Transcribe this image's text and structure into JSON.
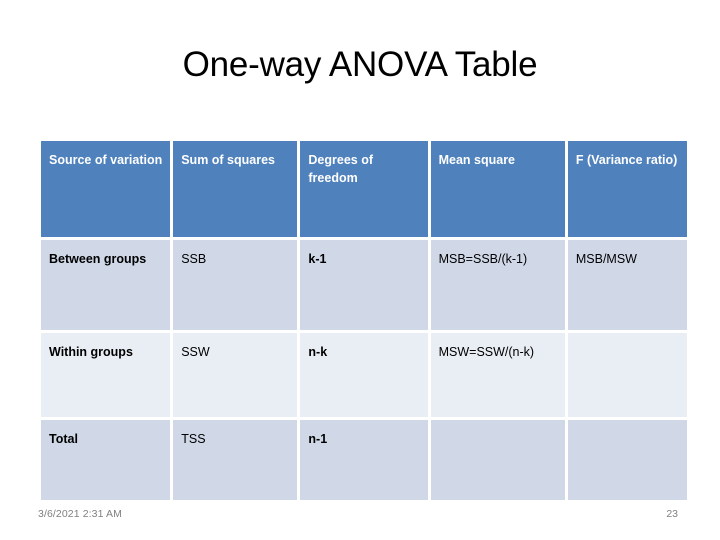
{
  "slide": {
    "title": "One-way ANOVA Table",
    "colors": {
      "header_fill": "#4F81BD",
      "band_row_fill": "#D0D8E8",
      "plain_row_fill": "#E9EDF4",
      "header_text": "#FFFFFF",
      "body_text": "#000000",
      "footer_text": "#808080"
    }
  },
  "table": {
    "headers": [
      "Source of variation",
      "Sum of squares",
      "Degrees of freedom",
      "Mean square",
      "F (Variance ratio)"
    ],
    "rows": [
      {
        "source": "Between groups",
        "sum_of_squares": "SSB",
        "degrees_of_freedom": "k-1",
        "mean_square": "MSB=SSB/(k-1)",
        "f_ratio": "MSB/MSW"
      },
      {
        "source": "Within groups",
        "sum_of_squares": "SSW",
        "degrees_of_freedom": "n-k",
        "mean_square": "MSW=SSW/(n-k)",
        "f_ratio": ""
      },
      {
        "source": "Total",
        "sum_of_squares": "TSS",
        "degrees_of_freedom": "n-1",
        "mean_square": "",
        "f_ratio": ""
      }
    ]
  },
  "footer": {
    "datetime": "3/6/2021 2:31 AM",
    "page_number": "23"
  }
}
